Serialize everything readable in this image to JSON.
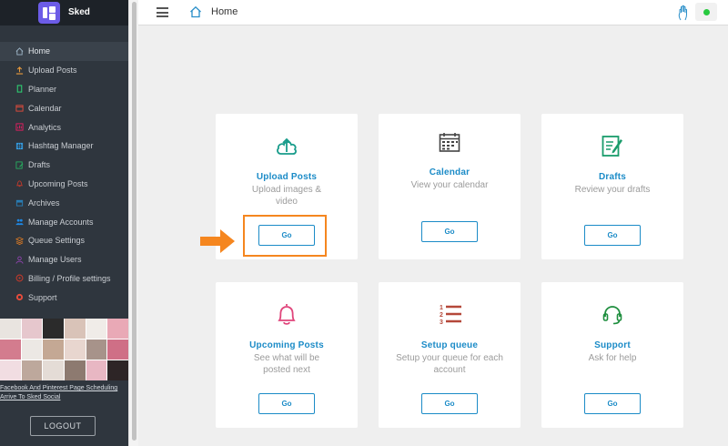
{
  "app": {
    "name": "Sked"
  },
  "colors": {
    "sidebar": "#2f363e",
    "accent": "#1b8bc7",
    "highlight": "#f5861f",
    "status": "#27c93f"
  },
  "topbar": {
    "title": "Home"
  },
  "sidebar": {
    "items": [
      {
        "label": "Home",
        "icon": "home-icon",
        "color": "#9fb7c9"
      },
      {
        "label": "Upload Posts",
        "icon": "upload-icon",
        "color": "#e89a3c"
      },
      {
        "label": "Planner",
        "icon": "planner-icon",
        "color": "#2ecc71"
      },
      {
        "label": "Calendar",
        "icon": "calendar-icon",
        "color": "#e74c3c"
      },
      {
        "label": "Analytics",
        "icon": "analytics-icon",
        "color": "#e91e63"
      },
      {
        "label": "Hashtag Manager",
        "icon": "hashtag-icon",
        "color": "#3498db"
      },
      {
        "label": "Drafts",
        "icon": "drafts-icon",
        "color": "#27ae60"
      },
      {
        "label": "Upcoming Posts",
        "icon": "bell-icon",
        "color": "#c0392b"
      },
      {
        "label": "Archives",
        "icon": "archive-icon",
        "color": "#2980b9"
      },
      {
        "label": "Manage Accounts",
        "icon": "accounts-icon",
        "color": "#1e88e5"
      },
      {
        "label": "Queue Settings",
        "icon": "queue-icon",
        "color": "#e67e22"
      },
      {
        "label": "Manage Users",
        "icon": "users-icon",
        "color": "#8e44ad"
      },
      {
        "label": "Billing / Profile settings",
        "icon": "billing-icon",
        "color": "#c0392b"
      },
      {
        "label": "Support",
        "icon": "support-icon",
        "color": "#e74c3c"
      }
    ],
    "promo_link": "Facebook And Pinterest Page Scheduling Arrive To Sked Social",
    "logout": "LOGOUT"
  },
  "cards": [
    {
      "title": "Upload Posts",
      "desc": "Upload images & video",
      "button": "Go",
      "icon": "cloud-upload-icon"
    },
    {
      "title": "Calendar",
      "desc": "View your calendar",
      "button": "Go",
      "icon": "calendar-icon"
    },
    {
      "title": "Drafts",
      "desc": "Review your drafts",
      "button": "Go",
      "icon": "drafts-icon"
    },
    {
      "title": "Upcoming Posts",
      "desc": "See what will be posted next",
      "button": "Go",
      "icon": "bell-icon"
    },
    {
      "title": "Setup queue",
      "desc": "Setup your queue for each account",
      "button": "Go",
      "icon": "numbered-list-icon"
    },
    {
      "title": "Support",
      "desc": "Ask for help",
      "button": "Go",
      "icon": "headset-icon"
    }
  ]
}
